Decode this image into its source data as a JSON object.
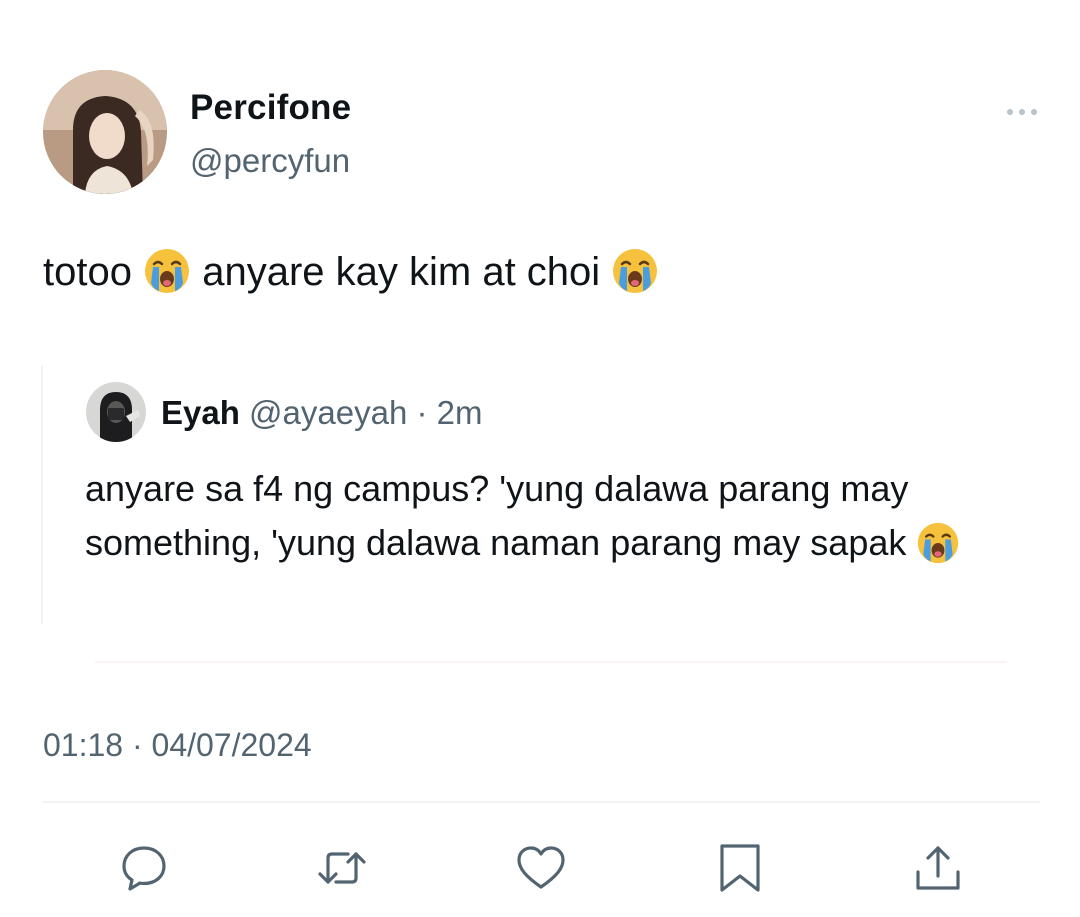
{
  "author": {
    "name": "Percifone",
    "handle": "@percyfun"
  },
  "tweet": {
    "text_1": "totoo",
    "text_2": "anyare kay kim at choi",
    "emoji": "loudly-crying-face"
  },
  "quote": {
    "name": "Eyah",
    "handle": "@ayaeyah",
    "separator": "·",
    "time": "2m",
    "text": "anyare sa f4 ng campus? 'yung dalawa parang may something, 'yung dalawa naman parang may sapak",
    "emoji": "loudly-crying-face"
  },
  "timestamp": "01:18 · 04/07/2024",
  "actions": [
    "reply-icon",
    "retweet-icon",
    "like-icon",
    "bookmark-icon",
    "share-icon"
  ],
  "colors": {
    "text": "#0f1419",
    "muted": "#536471",
    "emoji_face": "#f6c23e",
    "emoji_tears": "#4a9ee0"
  }
}
